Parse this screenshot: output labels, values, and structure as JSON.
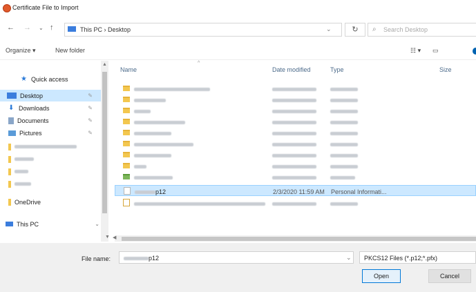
{
  "window": {
    "title": "Certificate File to Import"
  },
  "address": {
    "breadcrumb": "This PC  ›  Desktop",
    "search_placeholder": "Search Desktop"
  },
  "toolbar": {
    "organize": "Organize ▾",
    "new_folder": "New folder"
  },
  "nav": {
    "quick_access": "Quick access",
    "desktop": "Desktop",
    "downloads": "Downloads",
    "documents": "Documents",
    "pictures": "Pictures",
    "onedrive": "OneDrive",
    "this_pc": "This PC"
  },
  "columns": {
    "name": "Name",
    "date": "Date modified",
    "type": "Type",
    "size": "Size"
  },
  "files": {
    "selected_name_suffix": "p12",
    "selected_date": "2/3/2020 11:59 AM",
    "selected_type": "Personal Informati..."
  },
  "footer": {
    "file_name_label": "File name:",
    "file_name_value": "p12",
    "file_type": "PKCS12 Files (*.p12;*.pfx)",
    "open": "Open",
    "cancel": "Cancel"
  }
}
